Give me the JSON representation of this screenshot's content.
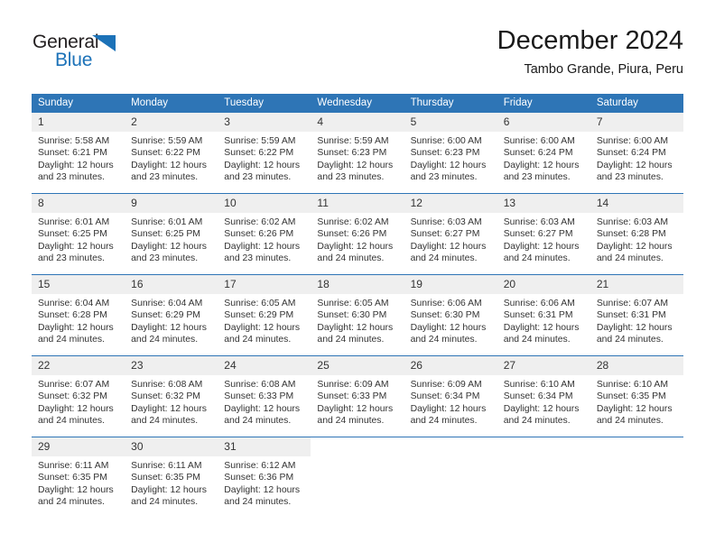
{
  "brand": {
    "name_part1": "General",
    "name_part2": "Blue",
    "triangle_color": "#1c72b8",
    "text_color": "#231f20"
  },
  "header": {
    "title": "December 2024",
    "subtitle": "Tambo Grande, Piura, Peru"
  },
  "theme": {
    "header_blue": "#2e75b6",
    "daynum_background": "#efefef",
    "text_color": "#333333"
  },
  "calendar": {
    "weekday_headers": [
      "Sunday",
      "Monday",
      "Tuesday",
      "Wednesday",
      "Thursday",
      "Friday",
      "Saturday"
    ],
    "weeks": [
      [
        {
          "day": "1",
          "sunrise": "Sunrise: 5:58 AM",
          "sunset": "Sunset: 6:21 PM",
          "daylight_line1": "Daylight: 12 hours",
          "daylight_line2": "and 23 minutes."
        },
        {
          "day": "2",
          "sunrise": "Sunrise: 5:59 AM",
          "sunset": "Sunset: 6:22 PM",
          "daylight_line1": "Daylight: 12 hours",
          "daylight_line2": "and 23 minutes."
        },
        {
          "day": "3",
          "sunrise": "Sunrise: 5:59 AM",
          "sunset": "Sunset: 6:22 PM",
          "daylight_line1": "Daylight: 12 hours",
          "daylight_line2": "and 23 minutes."
        },
        {
          "day": "4",
          "sunrise": "Sunrise: 5:59 AM",
          "sunset": "Sunset: 6:23 PM",
          "daylight_line1": "Daylight: 12 hours",
          "daylight_line2": "and 23 minutes."
        },
        {
          "day": "5",
          "sunrise": "Sunrise: 6:00 AM",
          "sunset": "Sunset: 6:23 PM",
          "daylight_line1": "Daylight: 12 hours",
          "daylight_line2": "and 23 minutes."
        },
        {
          "day": "6",
          "sunrise": "Sunrise: 6:00 AM",
          "sunset": "Sunset: 6:24 PM",
          "daylight_line1": "Daylight: 12 hours",
          "daylight_line2": "and 23 minutes."
        },
        {
          "day": "7",
          "sunrise": "Sunrise: 6:00 AM",
          "sunset": "Sunset: 6:24 PM",
          "daylight_line1": "Daylight: 12 hours",
          "daylight_line2": "and 23 minutes."
        }
      ],
      [
        {
          "day": "8",
          "sunrise": "Sunrise: 6:01 AM",
          "sunset": "Sunset: 6:25 PM",
          "daylight_line1": "Daylight: 12 hours",
          "daylight_line2": "and 23 minutes."
        },
        {
          "day": "9",
          "sunrise": "Sunrise: 6:01 AM",
          "sunset": "Sunset: 6:25 PM",
          "daylight_line1": "Daylight: 12 hours",
          "daylight_line2": "and 23 minutes."
        },
        {
          "day": "10",
          "sunrise": "Sunrise: 6:02 AM",
          "sunset": "Sunset: 6:26 PM",
          "daylight_line1": "Daylight: 12 hours",
          "daylight_line2": "and 23 minutes."
        },
        {
          "day": "11",
          "sunrise": "Sunrise: 6:02 AM",
          "sunset": "Sunset: 6:26 PM",
          "daylight_line1": "Daylight: 12 hours",
          "daylight_line2": "and 24 minutes."
        },
        {
          "day": "12",
          "sunrise": "Sunrise: 6:03 AM",
          "sunset": "Sunset: 6:27 PM",
          "daylight_line1": "Daylight: 12 hours",
          "daylight_line2": "and 24 minutes."
        },
        {
          "day": "13",
          "sunrise": "Sunrise: 6:03 AM",
          "sunset": "Sunset: 6:27 PM",
          "daylight_line1": "Daylight: 12 hours",
          "daylight_line2": "and 24 minutes."
        },
        {
          "day": "14",
          "sunrise": "Sunrise: 6:03 AM",
          "sunset": "Sunset: 6:28 PM",
          "daylight_line1": "Daylight: 12 hours",
          "daylight_line2": "and 24 minutes."
        }
      ],
      [
        {
          "day": "15",
          "sunrise": "Sunrise: 6:04 AM",
          "sunset": "Sunset: 6:28 PM",
          "daylight_line1": "Daylight: 12 hours",
          "daylight_line2": "and 24 minutes."
        },
        {
          "day": "16",
          "sunrise": "Sunrise: 6:04 AM",
          "sunset": "Sunset: 6:29 PM",
          "daylight_line1": "Daylight: 12 hours",
          "daylight_line2": "and 24 minutes."
        },
        {
          "day": "17",
          "sunrise": "Sunrise: 6:05 AM",
          "sunset": "Sunset: 6:29 PM",
          "daylight_line1": "Daylight: 12 hours",
          "daylight_line2": "and 24 minutes."
        },
        {
          "day": "18",
          "sunrise": "Sunrise: 6:05 AM",
          "sunset": "Sunset: 6:30 PM",
          "daylight_line1": "Daylight: 12 hours",
          "daylight_line2": "and 24 minutes."
        },
        {
          "day": "19",
          "sunrise": "Sunrise: 6:06 AM",
          "sunset": "Sunset: 6:30 PM",
          "daylight_line1": "Daylight: 12 hours",
          "daylight_line2": "and 24 minutes."
        },
        {
          "day": "20",
          "sunrise": "Sunrise: 6:06 AM",
          "sunset": "Sunset: 6:31 PM",
          "daylight_line1": "Daylight: 12 hours",
          "daylight_line2": "and 24 minutes."
        },
        {
          "day": "21",
          "sunrise": "Sunrise: 6:07 AM",
          "sunset": "Sunset: 6:31 PM",
          "daylight_line1": "Daylight: 12 hours",
          "daylight_line2": "and 24 minutes."
        }
      ],
      [
        {
          "day": "22",
          "sunrise": "Sunrise: 6:07 AM",
          "sunset": "Sunset: 6:32 PM",
          "daylight_line1": "Daylight: 12 hours",
          "daylight_line2": "and 24 minutes."
        },
        {
          "day": "23",
          "sunrise": "Sunrise: 6:08 AM",
          "sunset": "Sunset: 6:32 PM",
          "daylight_line1": "Daylight: 12 hours",
          "daylight_line2": "and 24 minutes."
        },
        {
          "day": "24",
          "sunrise": "Sunrise: 6:08 AM",
          "sunset": "Sunset: 6:33 PM",
          "daylight_line1": "Daylight: 12 hours",
          "daylight_line2": "and 24 minutes."
        },
        {
          "day": "25",
          "sunrise": "Sunrise: 6:09 AM",
          "sunset": "Sunset: 6:33 PM",
          "daylight_line1": "Daylight: 12 hours",
          "daylight_line2": "and 24 minutes."
        },
        {
          "day": "26",
          "sunrise": "Sunrise: 6:09 AM",
          "sunset": "Sunset: 6:34 PM",
          "daylight_line1": "Daylight: 12 hours",
          "daylight_line2": "and 24 minutes."
        },
        {
          "day": "27",
          "sunrise": "Sunrise: 6:10 AM",
          "sunset": "Sunset: 6:34 PM",
          "daylight_line1": "Daylight: 12 hours",
          "daylight_line2": "and 24 minutes."
        },
        {
          "day": "28",
          "sunrise": "Sunrise: 6:10 AM",
          "sunset": "Sunset: 6:35 PM",
          "daylight_line1": "Daylight: 12 hours",
          "daylight_line2": "and 24 minutes."
        }
      ],
      [
        {
          "day": "29",
          "sunrise": "Sunrise: 6:11 AM",
          "sunset": "Sunset: 6:35 PM",
          "daylight_line1": "Daylight: 12 hours",
          "daylight_line2": "and 24 minutes."
        },
        {
          "day": "30",
          "sunrise": "Sunrise: 6:11 AM",
          "sunset": "Sunset: 6:35 PM",
          "daylight_line1": "Daylight: 12 hours",
          "daylight_line2": "and 24 minutes."
        },
        {
          "day": "31",
          "sunrise": "Sunrise: 6:12 AM",
          "sunset": "Sunset: 6:36 PM",
          "daylight_line1": "Daylight: 12 hours",
          "daylight_line2": "and 24 minutes."
        },
        {
          "day": "",
          "sunrise": "",
          "sunset": "",
          "daylight_line1": "",
          "daylight_line2": ""
        },
        {
          "day": "",
          "sunrise": "",
          "sunset": "",
          "daylight_line1": "",
          "daylight_line2": ""
        },
        {
          "day": "",
          "sunrise": "",
          "sunset": "",
          "daylight_line1": "",
          "daylight_line2": ""
        },
        {
          "day": "",
          "sunrise": "",
          "sunset": "",
          "daylight_line1": "",
          "daylight_line2": ""
        }
      ]
    ]
  }
}
